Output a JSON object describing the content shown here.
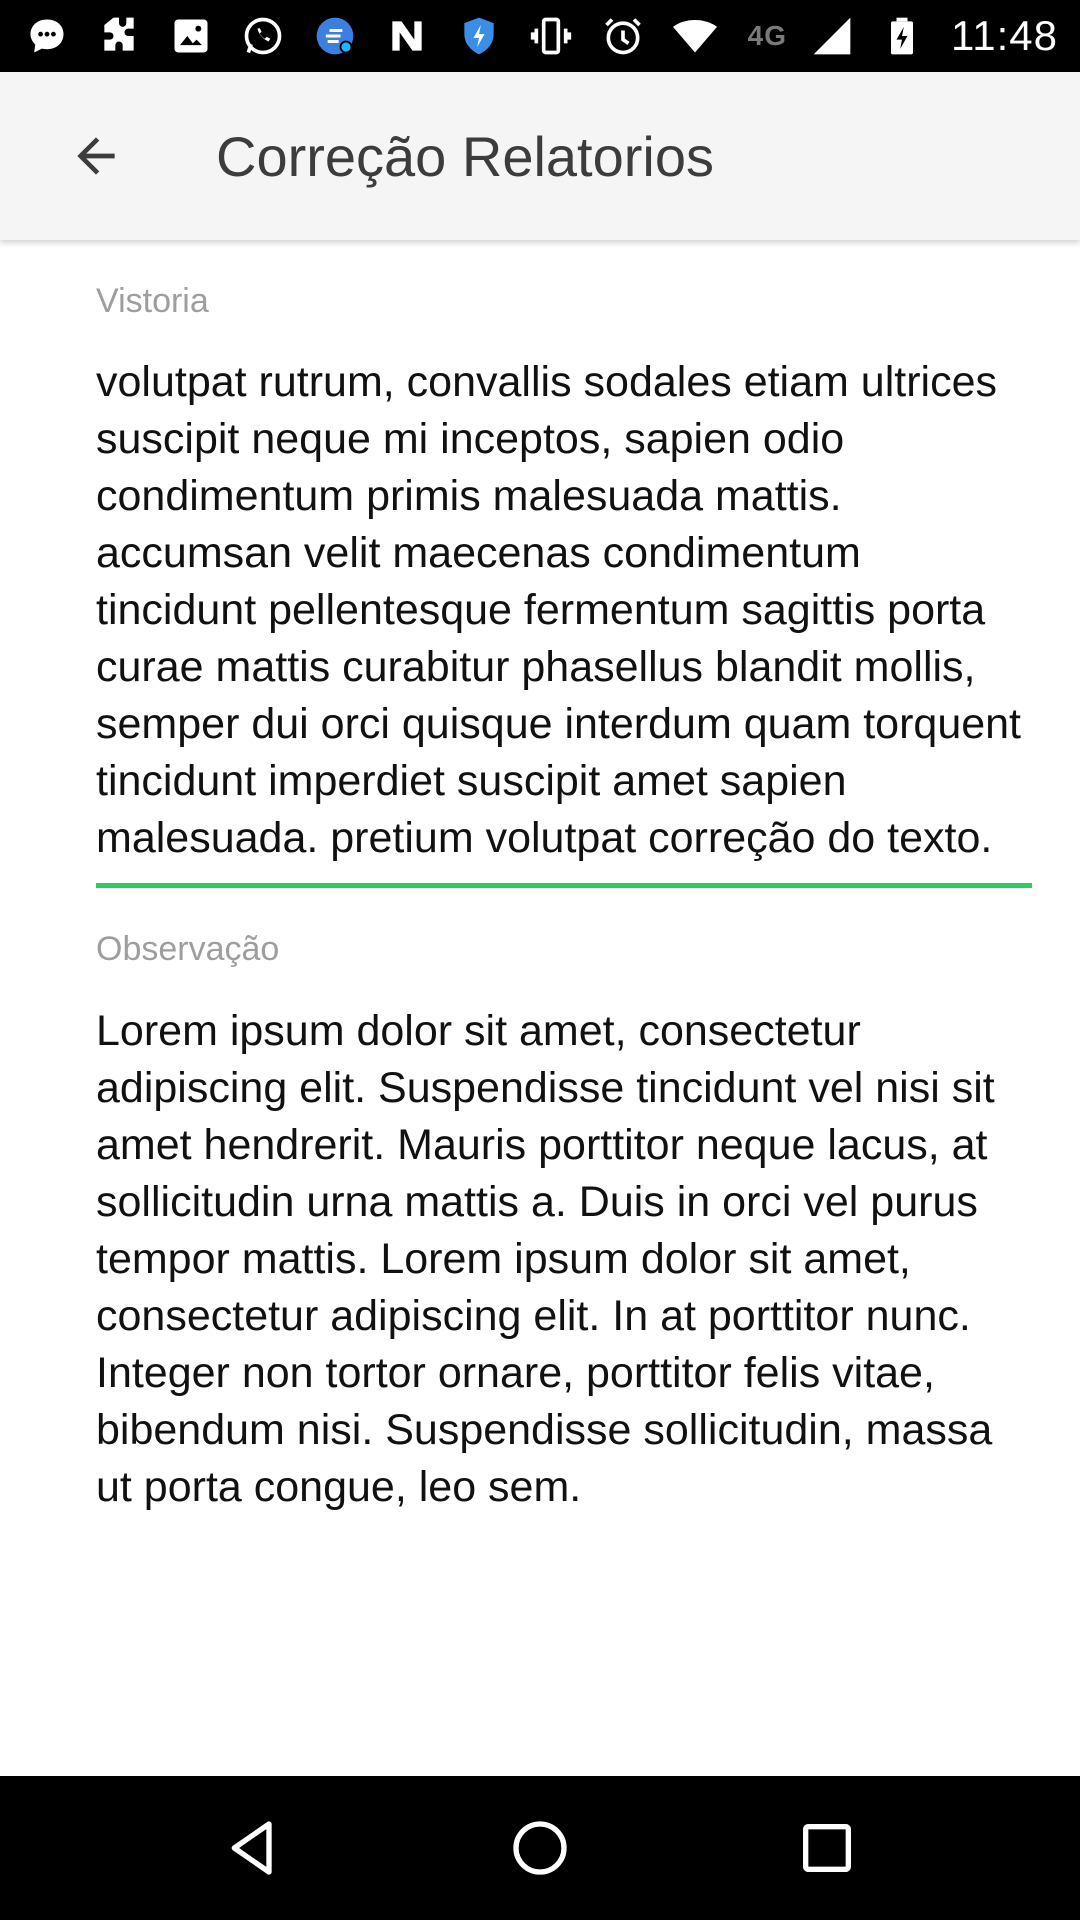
{
  "status_bar": {
    "network": "4G",
    "time": "11:48",
    "icons": [
      "messages-icon",
      "puzzle-icon",
      "image-icon",
      "whatsapp-icon",
      "cleaner-app-icon",
      "n-app-icon",
      "shield-icon",
      "vibrate-icon",
      "alarm-icon",
      "wifi-icon",
      "signal-icon",
      "battery-charging-icon"
    ]
  },
  "app_bar": {
    "title": "Correção Relatorios",
    "back_icon": "arrow-back-icon"
  },
  "form": {
    "vistoria": {
      "label": "Vistoria",
      "value": "volutpat rutrum, convallis sodales etiam ultrices suscipit neque mi inceptos, sapien odio condimentum primis malesuada mattis. accumsan velit maecenas condimentum tincidunt pellentesque fermentum sagittis porta curae mattis curabitur phasellus blandit mollis, semper dui orci quisque interdum quam torquent tincidunt imperdiet suscipit amet sapien malesuada. pretium volutpat correção do texto.",
      "underline_color": "#2ecc5f"
    },
    "observacao": {
      "label": "Observação",
      "value": "Lorem ipsum dolor sit amet, consectetur adipiscing elit. Suspendisse tincidunt vel nisi sit amet hendrerit. Mauris porttitor neque lacus, at sollicitudin urna mattis a. Duis in orci vel purus tempor mattis. Lorem ipsum dolor sit amet, consectetur adipiscing elit. In at porttitor nunc. Integer non tortor ornare, porttitor felis vitae, bibendum nisi. Suspendisse sollicitudin, massa ut porta congue, leo sem."
    }
  },
  "nav_bar": {
    "icons": [
      "nav-back-icon",
      "nav-home-icon",
      "nav-recents-icon"
    ]
  }
}
